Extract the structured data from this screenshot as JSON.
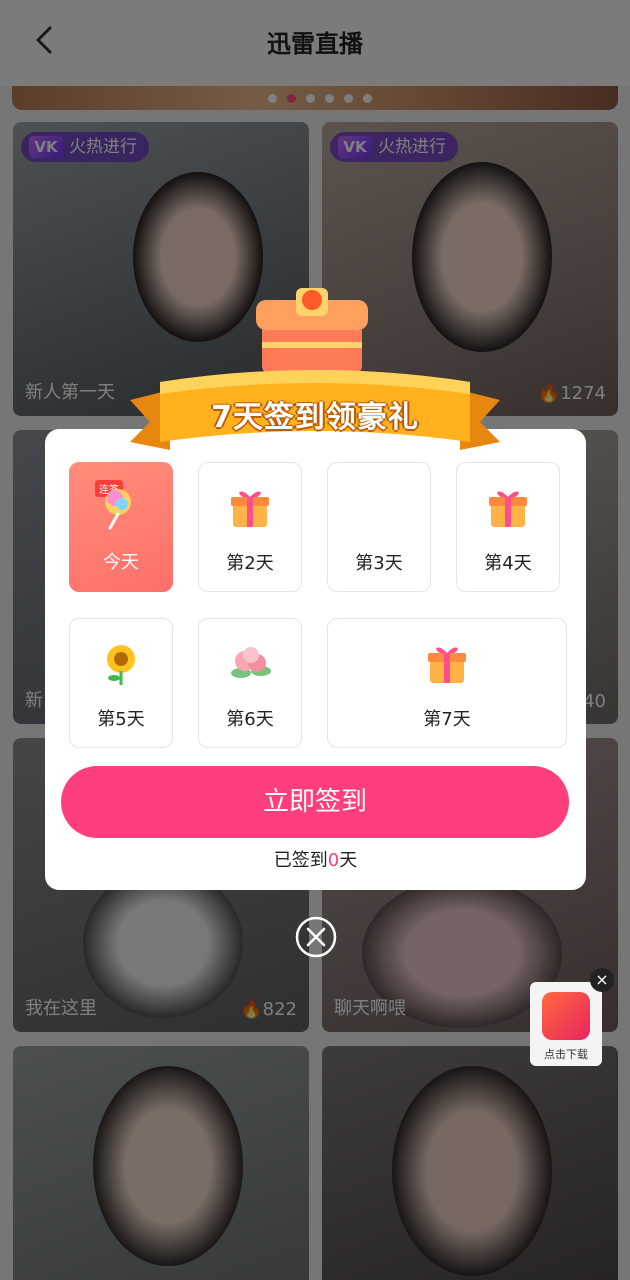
{
  "header": {
    "title": "迅雷直播"
  },
  "cards": [
    {
      "badge": "火热进行",
      "badge_logo": "VK",
      "caption": "新人第一天",
      "views": "1274"
    },
    {
      "badge": "火热进行",
      "badge_logo": "VK",
      "caption": "新",
      "views": "40"
    },
    {
      "caption": "我在这里",
      "views": "822"
    },
    {
      "caption": "聊天啊喂",
      "views": ""
    }
  ],
  "popup": {
    "banner_title": "7天签到领豪礼",
    "days": [
      {
        "label": "今天",
        "tag": "连签",
        "icon": "lollipop-icon"
      },
      {
        "label": "第2天",
        "icon": "gift-icon"
      },
      {
        "label": "第3天",
        "icon": ""
      },
      {
        "label": "第4天",
        "icon": "gift-icon"
      },
      {
        "label": "第5天",
        "icon": "sunflower-icon"
      },
      {
        "label": "第6天",
        "icon": "flower-icon"
      },
      {
        "label": "第7天",
        "icon": "gift-icon"
      }
    ],
    "sign_button": "立即签到",
    "signed_prefix": "已签到",
    "signed_count": "0",
    "signed_suffix": "天"
  },
  "floating_app": {
    "label": "点击下载"
  },
  "colors": {
    "accent": "#ff3f7d",
    "today_card": "#ff7a6f"
  }
}
